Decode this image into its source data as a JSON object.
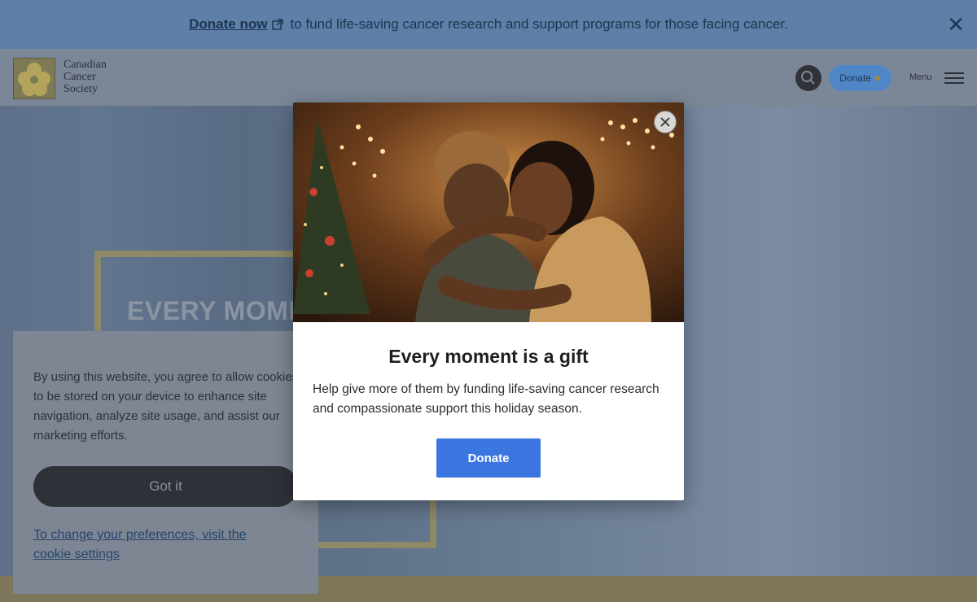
{
  "banner": {
    "link_text": "Donate now",
    "message": "to fund life-saving cancer research and support programs for those facing cancer.",
    "close_icon": "close-icon"
  },
  "header": {
    "logo_lines": [
      "Canadian",
      "Cancer",
      "Society"
    ],
    "donate_label": "Donate",
    "menu_label": "Menu"
  },
  "hero": {
    "title": "EVERY MOMENT"
  },
  "cookie": {
    "text": "By using this website, you agree to allow cookies to be stored on your device to enhance site navigation, analyze site usage, and assist our marketing efforts.",
    "button_label": "Got it",
    "settings_link": "To change your preferences, visit the cookie settings"
  },
  "modal": {
    "title": "Every moment is a gift",
    "body": "Help give more of them by funding life-saving cancer research and compassionate support this holiday season.",
    "donate_label": "Donate",
    "photo_icon": "holiday-hug-photo"
  },
  "colors": {
    "accent_blue": "#3b75e0",
    "brand_yellow": "#f2c230",
    "overlay": "#1e2a3a"
  }
}
